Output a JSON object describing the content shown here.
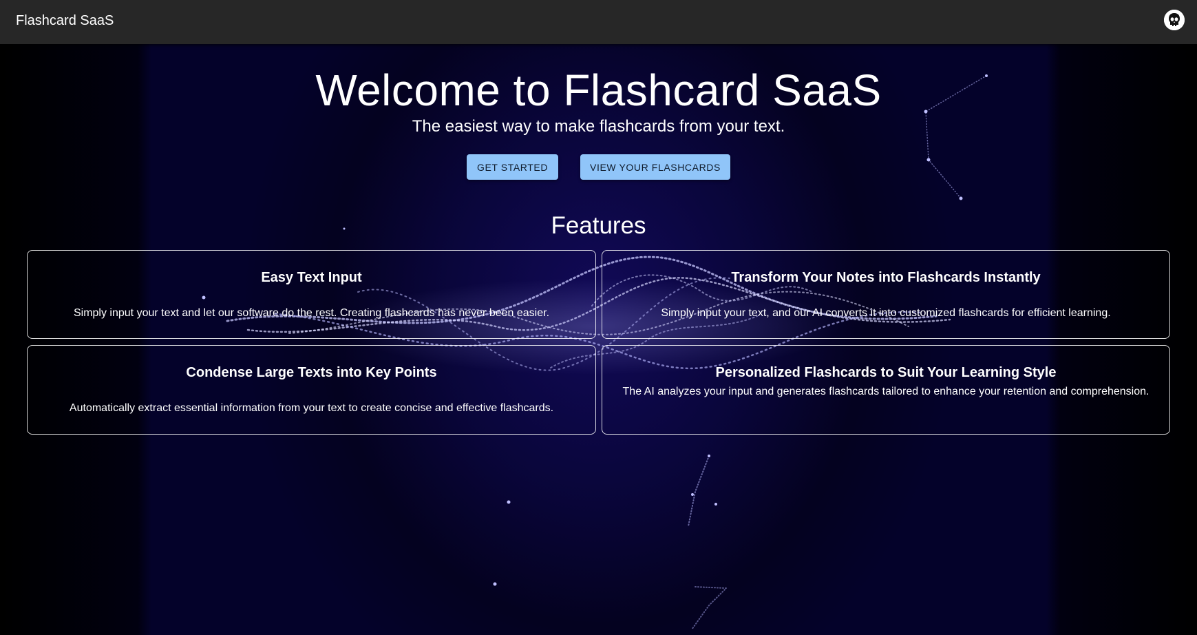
{
  "navbar": {
    "brand": "Flashcard SaaS"
  },
  "hero": {
    "title": "Welcome to Flashcard SaaS",
    "subtitle": "The easiest way to make flashcards from your text.",
    "get_started_label": "GET STARTED",
    "view_flashcards_label": "VIEW YOUR FLASHCARDS"
  },
  "features": {
    "heading": "Features",
    "items": [
      {
        "title": "Easy Text Input",
        "description": "Simply input your text and let our software do the rest. Creating flashcards has never been easier."
      },
      {
        "title": "Transform Your Notes into Flashcards Instantly",
        "description": "Simply input your text, and our AI converts it into customized flashcards for efficient learning."
      },
      {
        "title": "Condense Large Texts into Key Points",
        "description": "Automatically extract essential information from your text to create concise and effective flashcards."
      },
      {
        "title": "Personalized Flashcards to Suit Your Learning Style",
        "description": "The AI analyzes your input and generates flashcards tailored to enhance your retention and comprehension."
      }
    ]
  },
  "colors": {
    "navbar_bg": "#272727",
    "button_bg": "#90c5f9",
    "page_bg": "#04022a"
  },
  "icons": {
    "avatar": "skull-avatar-icon"
  }
}
